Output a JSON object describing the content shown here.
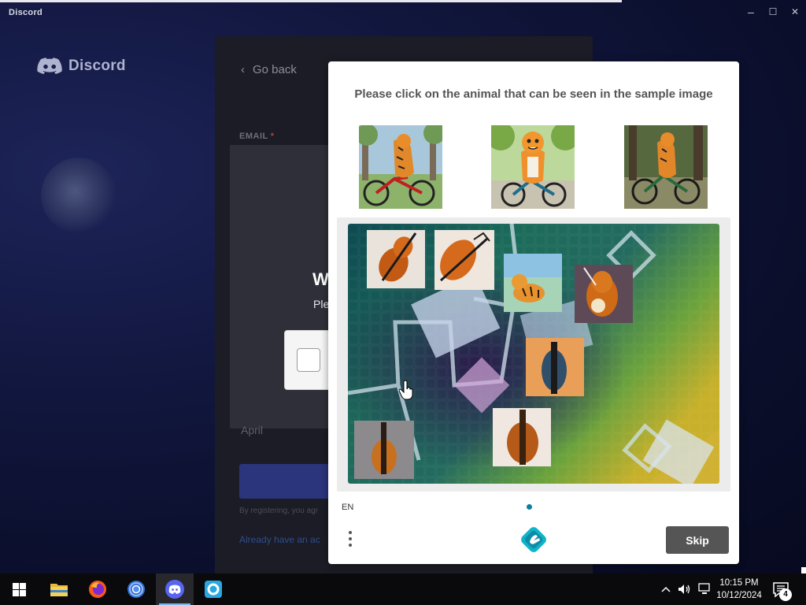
{
  "window": {
    "title": "Discord",
    "controls": {
      "minimize": "–",
      "maximize": "☐",
      "close": "✕"
    }
  },
  "discord": {
    "brand": "Discord",
    "go_back": "Go back",
    "email_label": "EMAIL",
    "required_mark": "*",
    "dob_month": "April",
    "legal_text": "By registering, you agr",
    "login_link": "Already have an ac",
    "verify_title": "W",
    "verify_sub": "Ple"
  },
  "captcha": {
    "prompt": "Please click on the animal that can be seen in the sample image",
    "language": "EN",
    "skip_label": "Skip",
    "icons": {
      "menu": "menu-icon",
      "logo": "hcaptcha-logo-icon"
    },
    "sample_images": [
      "tiger on red bicycle in park",
      "cartoon tiger on bicycle",
      "tiger riding bicycle in forest"
    ],
    "task_image_items": [
      "violin",
      "violin",
      "tiger",
      "violin",
      "violin",
      "violin",
      "violin"
    ]
  },
  "taskbar": {
    "apps": [
      {
        "name": "file-explorer-icon",
        "active": false
      },
      {
        "name": "firefox-icon",
        "active": false
      },
      {
        "name": "chrome-icon",
        "active": false
      },
      {
        "name": "discord-icon",
        "active": true
      },
      {
        "name": "app-icon",
        "active": false
      }
    ],
    "time": "10:15 PM",
    "date": "10/12/2024",
    "notification_count": "4"
  },
  "colors": {
    "accent_blurple": "#5865f2",
    "skip_button": "#555555",
    "hcaptcha_teal": "#0e7ea3"
  }
}
